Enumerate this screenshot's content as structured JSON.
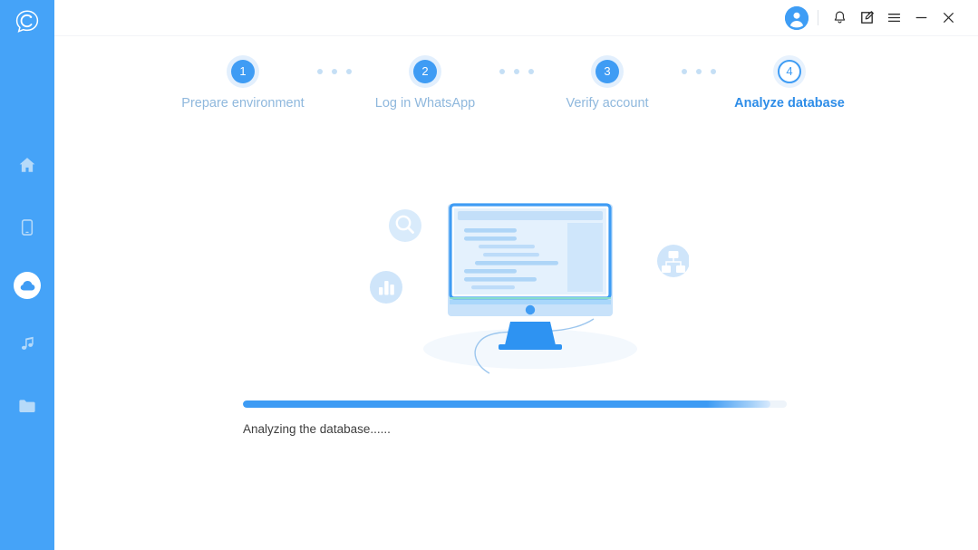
{
  "app": {
    "logo_icon": "chat-bubble-c-logo",
    "accent_color": "#45a3f8",
    "sidebar_bg": "#45a3f8"
  },
  "sidebar": {
    "items": [
      {
        "name": "home",
        "icon": "home-icon",
        "active": false
      },
      {
        "name": "device",
        "icon": "phone-icon",
        "active": false
      },
      {
        "name": "transfer",
        "icon": "cloud-icon",
        "active": true
      },
      {
        "name": "music",
        "icon": "music-note-icon",
        "active": false
      },
      {
        "name": "files",
        "icon": "folder-icon",
        "active": false
      }
    ]
  },
  "titlebar": {
    "avatar_icon": "user-avatar-icon",
    "notification_icon": "bell-icon",
    "feedback_icon": "edit-note-icon",
    "menu_icon": "hamburger-menu-icon",
    "minimize_icon": "minimize-icon",
    "close_icon": "close-icon"
  },
  "steps": {
    "items": [
      {
        "number": "1",
        "label": "Prepare environment",
        "active": false
      },
      {
        "number": "2",
        "label": "Log in WhatsApp",
        "active": false
      },
      {
        "number": "3",
        "label": "Verify account",
        "active": false
      },
      {
        "number": "4",
        "label": "Analyze database",
        "active": true
      }
    ],
    "separator_dot_count": 3,
    "inactive_color": "#8fb8dd",
    "active_color": "#2e8de8"
  },
  "illustration": {
    "name": "database-analysis-monitor-illustration",
    "badges": [
      {
        "name": "search-badge",
        "icon": "magnifier-icon"
      },
      {
        "name": "chart-badge",
        "icon": "bar-chart-icon"
      },
      {
        "name": "hierarchy-badge",
        "icon": "sitemap-icon"
      }
    ]
  },
  "progress": {
    "percent": 97,
    "status_text": "Analyzing the database......",
    "fill_color": "#3d9bf4",
    "track_color": "#eef4fa"
  }
}
